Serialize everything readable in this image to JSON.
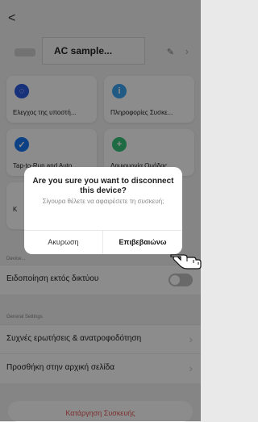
{
  "header": {
    "back": "<",
    "device_title": "AC sample...",
    "edit_icon": "✎",
    "chevron": "›"
  },
  "tiles": [
    {
      "label": "Ελεγχος της υποστή...",
      "icon": "network-check-icon",
      "color": "#2a5adf"
    },
    {
      "label": "Πληροφορίες Συσκε...",
      "icon": "info-icon",
      "color": "#3da7f2"
    },
    {
      "label": "Tap-to-Run and Auto...",
      "icon": "check-icon",
      "color": "#1877f2"
    },
    {
      "label": "Δημιουργία Ομάδας",
      "icon": "group-add-icon",
      "color": "#35c17a"
    }
  ],
  "partial_tile_text": "K",
  "sections": {
    "device": "Device...",
    "general": "General Settings"
  },
  "rows": [
    {
      "label": "Ειδοποίηση εκτός δικτύου",
      "control": "toggle-off"
    },
    {
      "label": "Συχνές ερωτήσεις & ανατροφοδότηση",
      "control": "chevron"
    },
    {
      "label": "Προσθήκη στην αρχική σελίδα",
      "control": "chevron"
    }
  ],
  "bottom_action": "Κατάργηση Συσκευής",
  "dialog": {
    "title": "Are you sure you want to disconnect this device?",
    "subtitle": "Σίγουρα θέλετε να αφαιρέσετε τη συσκευή;",
    "cancel": "Ακυρωση",
    "confirm": "Επιβεβαιώνω"
  },
  "colors": {
    "overlay": "rgba(0,0,0,0.45)",
    "danger": "#e35757",
    "toggle_off": "#bfbfbf"
  }
}
